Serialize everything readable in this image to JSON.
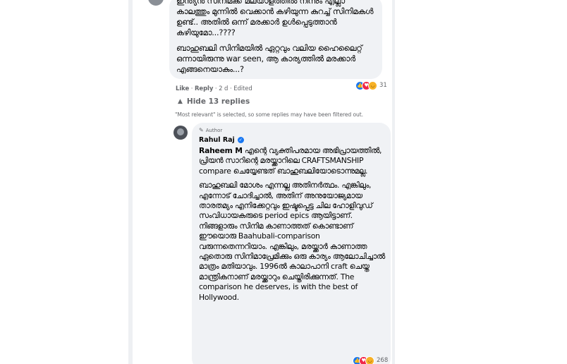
{
  "comment1": {
    "para1": "ഇന്ത്യൻ സിനിമക്ക് മലയാളത്തിൽ നിന്നും എല്ലാ കാലത്തും മുന്നിൽ വെക്കാൻ കഴിയുന്ന കുറച്ച് സിനിമകൾ ഉണ്ട്.. അതിൽ ഒന്ന് മരക്കാർ ഉൾപ്പെടുത്താൻ കഴിയുമോ...????",
    "para2": "ബാഹുബലി സിനിമയിൽ ഏറ്റവും വലിയ ഹൈലൈറ്റ് ഒന്നായിരുന്നു war seen, ആ കാര്യത്തിൽ മരക്കാർ എങ്ങനെയാകും...?",
    "like_label": "Like",
    "reply_label": "Reply",
    "time": "2 d",
    "edited_label": "Edited",
    "reaction_count": "31"
  },
  "replies_toggle": {
    "label": "Hide 13 replies",
    "filter_note": "\"Most relevant\" is selected, so some replies may have been filtered out."
  },
  "reply": {
    "author_badge": "Author",
    "name": "Rahul Raj",
    "mention": "Raheem M",
    "para1_rest": " എന്റെ വ്യക്തിപരമായ അഭിപ്രായത്തിൽ, പ്രിയൻ സാറിന്റെ മരയ്ക്കാറിലെ CRAFTSMANSHIP compare ചെയ്യേണ്ടത് ബാഹുബലിയോടൊന്നുമല്ല.",
    "para2": "ബാഹുബലി മോശം എന്നല്ല അതിനർത്ഥം. എങ്കിലും, എന്നോട് ചോദിച്ചാൽ, അതിന് അനുയോജ്യമായ താരതമ്യം എനിക്കേറ്റവും ഇഷ്ടപ്പെട്ട ചില ഹോളിവുഡ് സംവിധായകരുടെ period epics ആയിട്ടാണ്. നിങ്ങളാരും സിനിമ കാണാത്തത് കൊണ്ടാണ് ഈയൊരു Baahubali-comparison വരുന്നതെന്നറിയാം. എങ്കിലും, മരയ്ക്കാർ കാണാത്ത ഏതൊരു സിനിമാപ്രേമിക്കും ഒരു കാര്യം ആലോചിച്ചാൽ മാത്രം മതിയാവും. 1996ൽ കാലാപാനി craft ചെയ്ത മാന്ത്രികനാണ് മരയ്ക്കാറും ചെയ്തിരിക്കുന്നത്. The comparison he deserves, is with the best of Hollywood.",
    "reaction_count": "268"
  },
  "icons": {
    "like": "thumbs-up-icon",
    "love": "heart-icon",
    "haha": "laugh-icon",
    "caret": "caret-up-icon",
    "pen": "pen-icon",
    "verified": "verified-badge-icon"
  },
  "colors": {
    "bubble": "#f0f2f5",
    "meta": "#65676b",
    "like": "#1877f2",
    "love": "#f0284a",
    "haha": "#f7b125"
  }
}
